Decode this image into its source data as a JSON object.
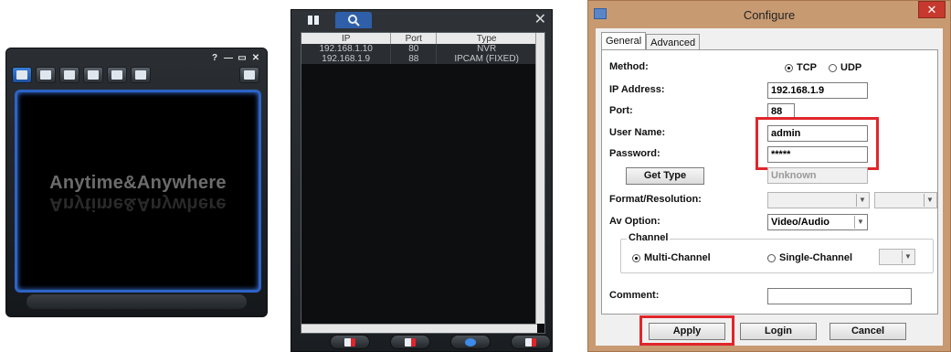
{
  "viewer": {
    "window_buttons": [
      "?",
      "—",
      "▭",
      "✕"
    ],
    "slogan": "Anytime&Anywhere",
    "toolbar_icons": [
      "live-view-icon",
      "playback-icon",
      "snapshot-icon",
      "settings-icon",
      "tools-icon",
      "info-icon"
    ]
  },
  "device_list": {
    "tab_icons": [
      "grid-view-icon",
      "search-icon"
    ],
    "close": "✕",
    "columns": [
      "IP",
      "Port",
      "Type"
    ],
    "rows": [
      {
        "ip": "192.168.1.10",
        "port": "80",
        "type": "NVR"
      },
      {
        "ip": "192.168.1.9",
        "port": "88",
        "type": "IPCAM (FIXED)"
      }
    ],
    "bottom_icons": [
      "add-device-icon",
      "add-group-icon",
      "refresh-icon",
      "cloud-add-icon"
    ]
  },
  "dialog": {
    "title": "Configure",
    "close": "✕",
    "tabs": [
      "General",
      "Advanced"
    ],
    "method_label": "Method:",
    "method_options": [
      "TCP",
      "UDP"
    ],
    "method_selected": "TCP",
    "ip_label": "IP Address:",
    "ip_value": "192.168.1.9",
    "port_label": "Port:",
    "port_value": "88",
    "user_label": "User Name:",
    "user_value": "admin",
    "password_label": "Password:",
    "password_value": "*****",
    "get_type_button": "Get Type",
    "type_value": "Unknown",
    "format_label": "Format/Resolution:",
    "av_label": "Av Option:",
    "av_value": "Video/Audio",
    "channel_group": "Channel",
    "channel_options": [
      "Multi-Channel",
      "Single-Channel"
    ],
    "channel_selected": "Multi-Channel",
    "comment_label": "Comment:",
    "comment_value": "",
    "apply_button": "Apply",
    "login_button": "Login",
    "cancel_button": "Cancel",
    "highlight_color": "#e0262b"
  }
}
